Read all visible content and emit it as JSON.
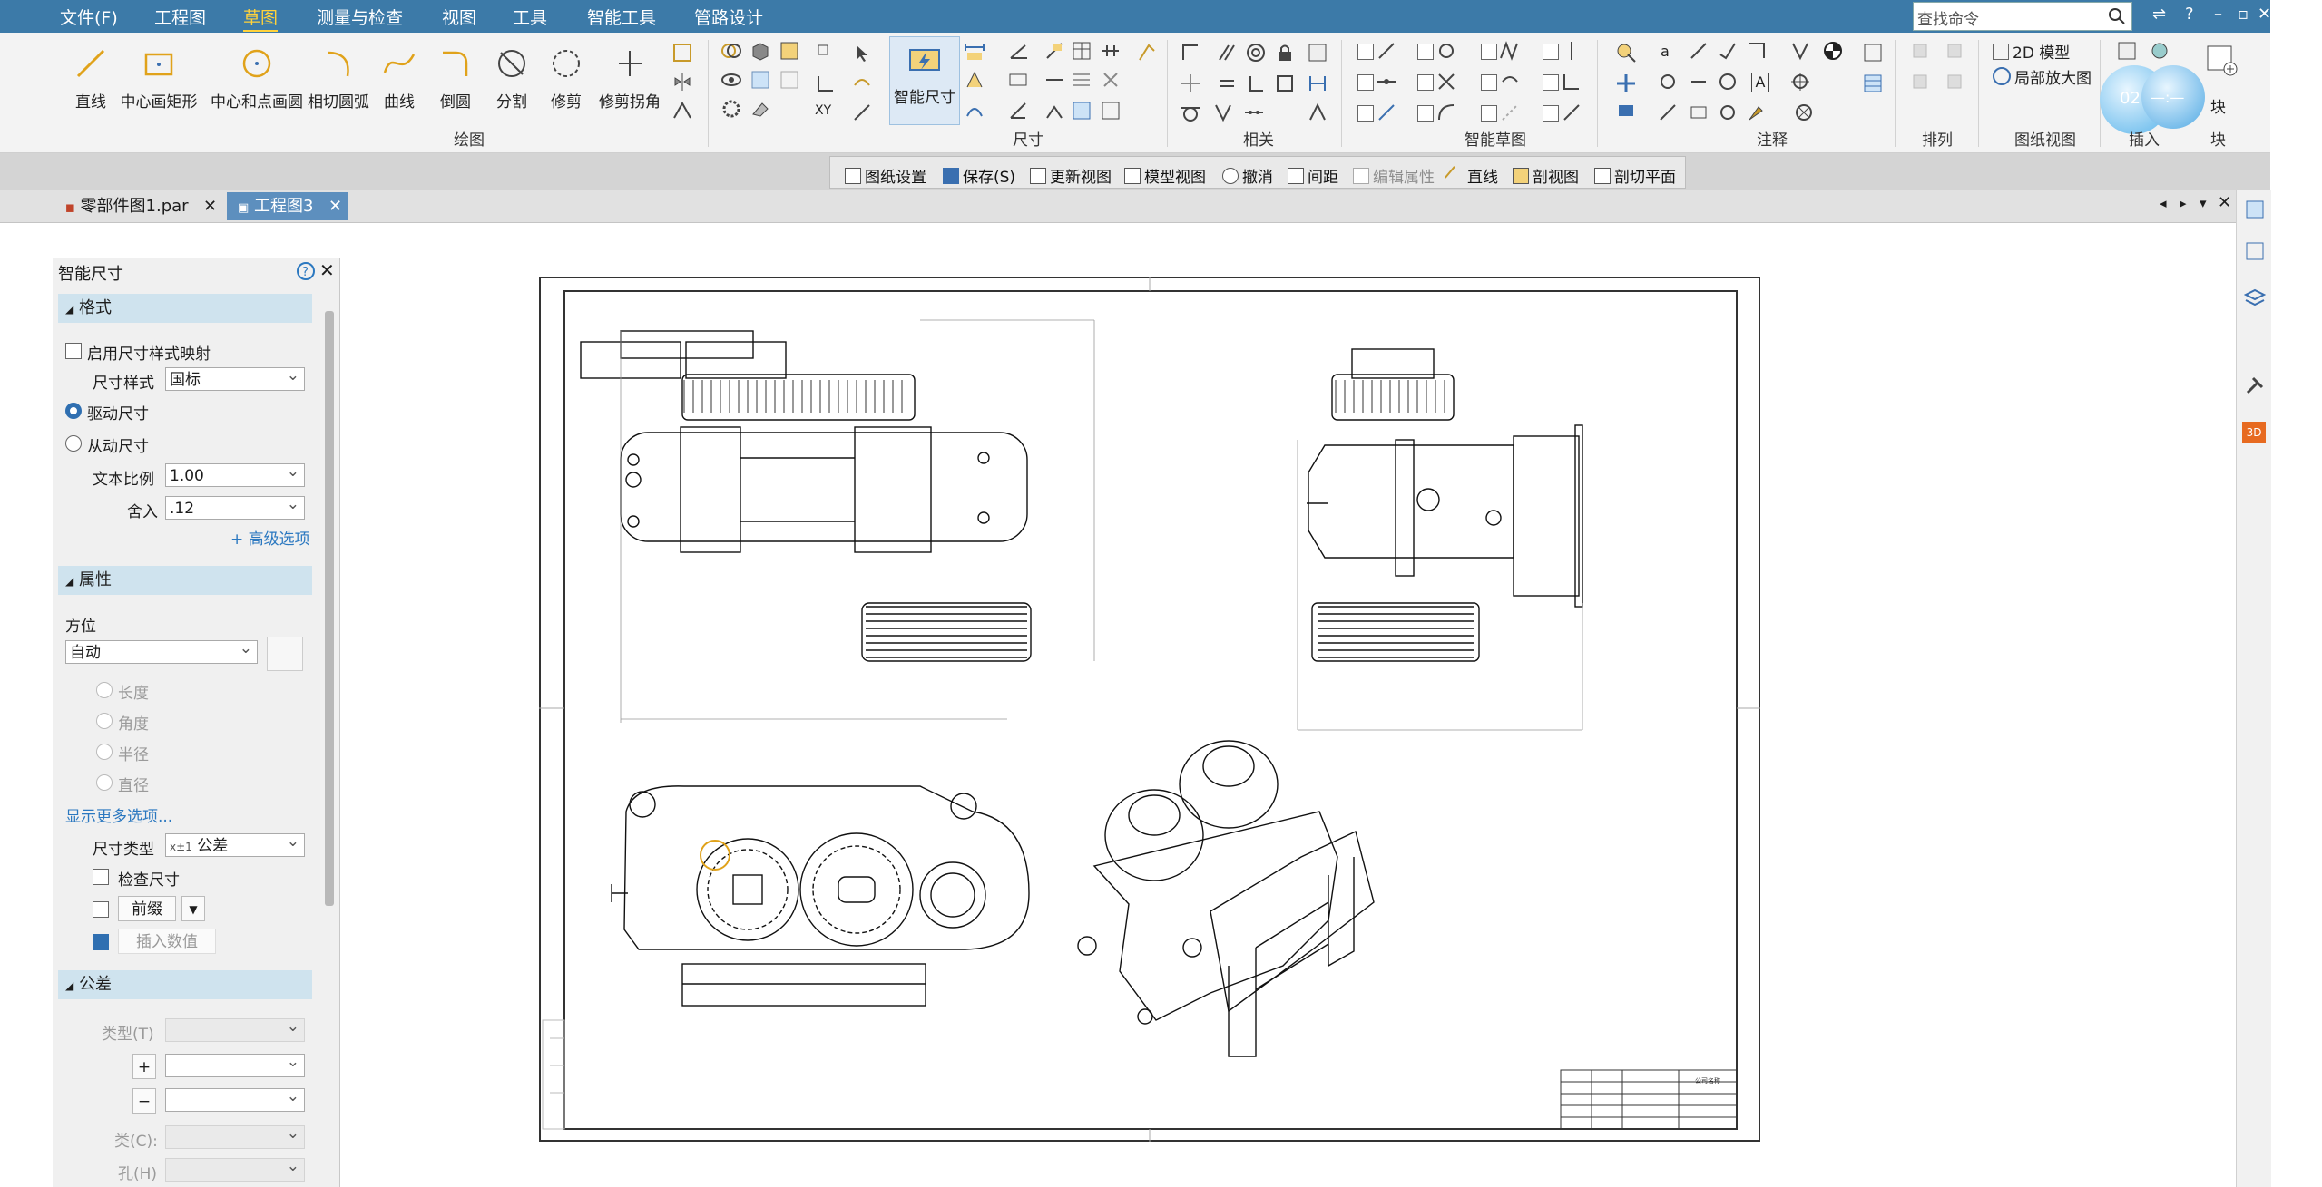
{
  "menubar": {
    "file": "文件(F)",
    "tabs": [
      "工程图",
      "草图",
      "测量与检查",
      "视图",
      "工具",
      "智能工具",
      "管路设计"
    ],
    "active_tab": "草图",
    "search_placeholder": "查找命令"
  },
  "ribbon": {
    "draw_tools": [
      "直线",
      "中心画矩形",
      "中心和点画圆",
      "相切圆弧",
      "曲线",
      "倒圆",
      "分割",
      "修剪",
      "修剪拐角"
    ],
    "smart_dimension": "智能尺寸",
    "groups": {
      "draw": "绘图",
      "dimension": "尺寸",
      "relate": "相关",
      "smart_sketch": "智能草图",
      "annotation": "注释",
      "arrange": "排列",
      "drawing_view": "图纸视图",
      "insert": "插入",
      "block": "块"
    },
    "model_2d": "2D 模型",
    "detail_view": "局部放大图",
    "block_label": "块",
    "clock": "02:2"
  },
  "context_toolbar": [
    "图纸设置",
    "保存(S)",
    "更新视图",
    "模型视图",
    "撤消",
    "间距",
    "编辑属性",
    "直线",
    "剖视图",
    "剖切平面"
  ],
  "doc_tabs": [
    {
      "label": "零部件图1.par",
      "active": false
    },
    {
      "label": "工程图3",
      "active": true
    }
  ],
  "panel": {
    "title": "智能尺寸",
    "format_section": "格式",
    "enable_style_map": "启用尺寸样式映射",
    "dim_style_label": "尺寸样式",
    "dim_style_value": "国标",
    "driving": "驱动尺寸",
    "driven": "从动尺寸",
    "text_scale_label": "文本比例",
    "text_scale_value": "1.00",
    "round_label": "舍入",
    "round_value": ".12",
    "advanced": "+ 高级选项",
    "props_section": "属性",
    "orientation_label": "方位",
    "orientation_value": "自动",
    "length": "长度",
    "angle": "角度",
    "radius": "半径",
    "diameter": "直径",
    "more_options": "显示更多选项...",
    "dim_type_label": "尺寸类型",
    "dim_type_value": "公差",
    "dim_type_prefix": "x±1",
    "check_dim": "检查尺寸",
    "prefix": "前缀",
    "insert_value": "插入数值",
    "tolerance_section": "公差",
    "type_label": "类型(T)",
    "class_label": "类(C):",
    "hole_label": "孔(H)"
  },
  "title_block_text": "公司名称"
}
